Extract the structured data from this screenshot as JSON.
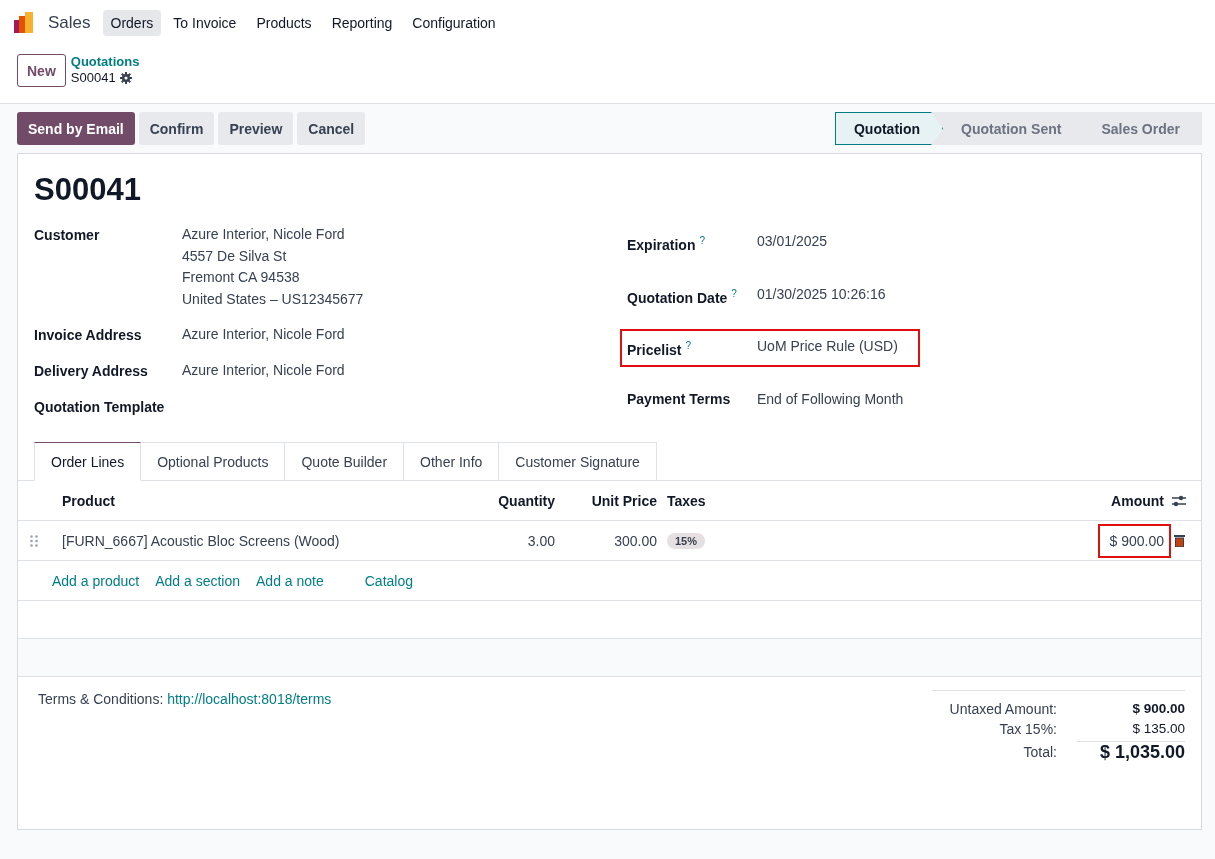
{
  "app": {
    "name": "Sales"
  },
  "menu": [
    {
      "label": "Orders",
      "selected": true
    },
    {
      "label": "To Invoice",
      "selected": false
    },
    {
      "label": "Products",
      "selected": false
    },
    {
      "label": "Reporting",
      "selected": false
    },
    {
      "label": "Configuration",
      "selected": false
    }
  ],
  "control_panel": {
    "new_button": "New",
    "breadcrumb": "Quotations",
    "record": "S00041"
  },
  "actions": [
    {
      "label": "Send by Email",
      "primary": true
    },
    {
      "label": "Confirm",
      "primary": false
    },
    {
      "label": "Preview",
      "primary": false
    },
    {
      "label": "Cancel",
      "primary": false
    }
  ],
  "status_bar": [
    {
      "label": "Quotation",
      "selected": true
    },
    {
      "label": "Quotation Sent",
      "selected": false
    },
    {
      "label": "Sales Order",
      "selected": false
    }
  ],
  "title": "S00041",
  "left_fields": [
    {
      "label": "Customer",
      "lines": [
        "Azure Interior, Nicole Ford",
        "4557 De Silva St",
        "Fremont CA 94538",
        "United States – US12345677"
      ]
    },
    {
      "label": "Invoice Address",
      "lines": [
        "Azure Interior, Nicole Ford"
      ]
    },
    {
      "label": "Delivery Address",
      "lines": [
        "Azure Interior, Nicole Ford"
      ]
    },
    {
      "label": "Quotation Template"
    }
  ],
  "right_fields": [
    {
      "label": "Expiration",
      "help": "?",
      "value": "03/01/2025",
      "highlighted": false
    },
    {
      "label": "Quotation Date",
      "help": "?",
      "value": "01/30/2025 10:26:16",
      "highlighted": false
    },
    {
      "label": "Pricelist",
      "help": "?",
      "value": "UoM Price Rule (USD)",
      "highlighted": true
    },
    {
      "label": "Payment Terms",
      "value": "End of Following Month",
      "highlighted": false
    }
  ],
  "tabs": [
    {
      "label": "Order Lines",
      "selected": true
    },
    {
      "label": "Optional Products",
      "selected": false
    },
    {
      "label": "Quote Builder",
      "selected": false
    },
    {
      "label": "Other Info",
      "selected": false
    },
    {
      "label": "Customer Signature",
      "selected": false
    }
  ],
  "table": {
    "columns": [
      "Product",
      "Quantity",
      "Unit Price",
      "Taxes",
      "Amount"
    ],
    "rows": [
      {
        "product": "[FURN_6667] Acoustic Bloc Screens (Wood)",
        "quantity": "3.00",
        "unit_price": "300.00",
        "tax": "15%",
        "amount": "$ 900.00",
        "amount_highlighted": true
      }
    ],
    "add_links": [
      "Add a product",
      "Add a section",
      "Add a note",
      "Catalog"
    ]
  },
  "terms": {
    "label": "Terms & Conditions:",
    "link": "http://localhost:8018/terms"
  },
  "totals": [
    {
      "label": "Untaxed Amount:",
      "value": "$ 900.00",
      "kind": "bold"
    },
    {
      "label": "Tax 15%:",
      "value": "$ 135.00",
      "kind": "plain"
    },
    {
      "label": "Total:",
      "value": "$ 1,035.00",
      "kind": "total"
    }
  ]
}
